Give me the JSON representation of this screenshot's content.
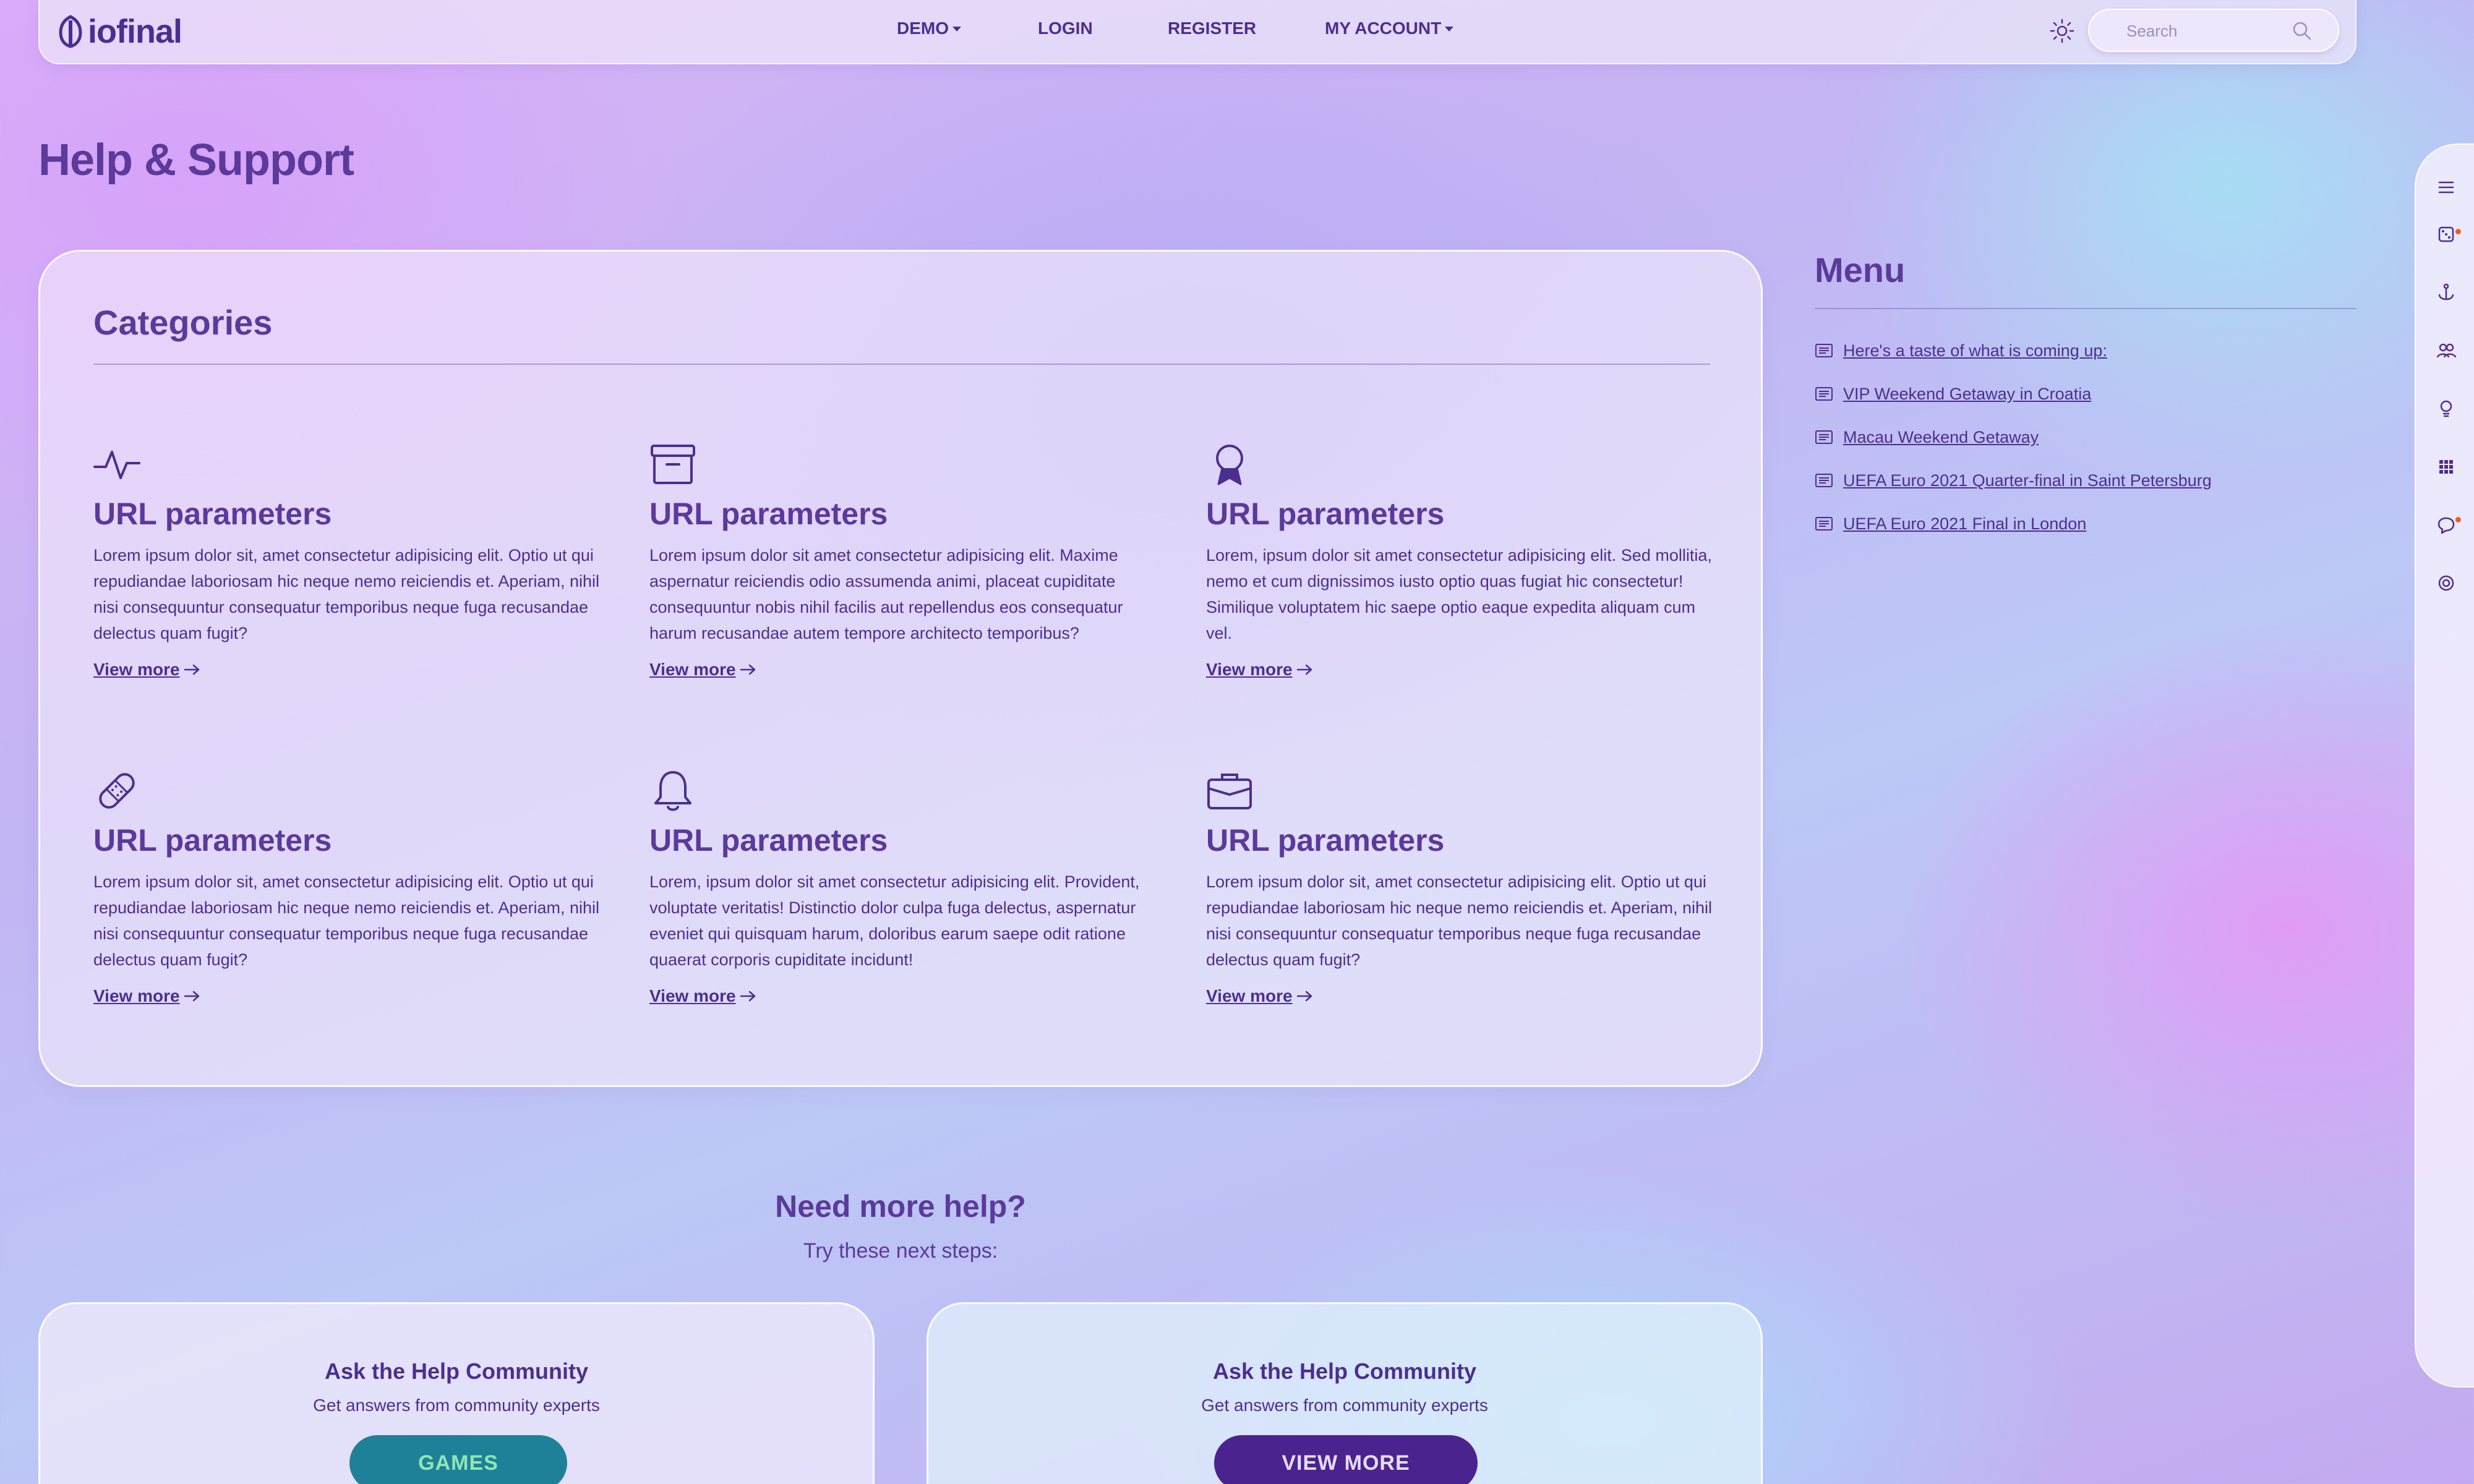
{
  "brand": {
    "name": "iofinal"
  },
  "nav": {
    "demo": "DEMO",
    "login": "LOGIN",
    "register": "REGISTER",
    "account": "MY ACCOUNT"
  },
  "search": {
    "placeholder": "Search"
  },
  "page": {
    "title": "Help & Support"
  },
  "categories": {
    "title": "Categories",
    "items": [
      {
        "icon": "activity-icon",
        "title": "URL parameters",
        "desc": "Lorem ipsum dolor sit, amet consectetur adipisicing elit. Optio ut qui repudiandae laboriosam hic neque nemo reiciendis et. Aperiam, nihil nisi consequuntur consequatur temporibus neque fuga recusandae delectus quam fugit?",
        "link": "View more"
      },
      {
        "icon": "archive-icon",
        "title": "URL parameters",
        "desc": "Lorem ipsum dolor sit amet consectetur adipisicing elit. Maxime aspernatur reiciendis odio assumenda animi, placeat cupiditate consequuntur nobis nihil facilis aut repellendus eos consequatur harum recusandae autem tempore architecto temporibus?",
        "link": "View more"
      },
      {
        "icon": "award-icon",
        "title": "URL parameters",
        "desc": "Lorem, ipsum dolor sit amet consectetur adipisicing elit. Sed mollitia, nemo et cum dignissimos iusto optio quas fugiat hic consectetur! Similique voluptatem hic saepe optio eaque expedita aliquam cum vel.",
        "link": "View more"
      },
      {
        "icon": "bandage-icon",
        "title": "URL parameters",
        "desc": "Lorem ipsum dolor sit, amet consectetur adipisicing elit. Optio ut qui repudiandae laboriosam hic neque nemo reiciendis et. Aperiam, nihil nisi consequuntur consequatur temporibus neque fuga recusandae delectus quam fugit?",
        "link": "View more"
      },
      {
        "icon": "bell-icon",
        "title": "URL parameters",
        "desc": "Lorem, ipsum dolor sit amet consectetur adipisicing elit. Provident, voluptate veritatis! Distinctio dolor culpa fuga delectus, aspernatur eveniet qui quisquam harum, doloribus earum saepe odit ratione quaerat corporis cupiditate incidunt!",
        "link": "View more"
      },
      {
        "icon": "briefcase-icon",
        "title": "URL parameters",
        "desc": "Lorem ipsum dolor sit, amet consectetur adipisicing elit. Optio ut qui repudiandae laboriosam hic neque nemo reiciendis et. Aperiam, nihil nisi consequuntur consequatur temporibus neque fuga recusandae delectus quam fugit?",
        "link": "View more"
      }
    ]
  },
  "menu": {
    "title": "Menu",
    "items": [
      "Here's a taste of what is coming up:",
      "VIP Weekend Getaway in Croatia",
      "Macau Weekend Getaway",
      "UEFA Euro 2021 Quarter-final in Saint Petersburg",
      "UEFA Euro 2021 Final in London"
    ]
  },
  "rail": {
    "icons": [
      "hamburger-menu-icon",
      "casino-icon",
      "anchor-icon",
      "users-icon",
      "lightbulb-icon",
      "grid-icon",
      "chat-icon",
      "target-icon"
    ]
  },
  "help": {
    "title": "Need more help?",
    "subtitle": "Try these next steps:",
    "cards": [
      {
        "title": "Ask the Help Community",
        "subtitle": "Get answers from community experts",
        "button": "GAMES"
      },
      {
        "title": "Ask the Help Community",
        "subtitle": "Get answers from community experts",
        "button": "VIEW MORE"
      }
    ]
  },
  "colors": {
    "primary_text": "#4b2f8f",
    "heading": "#5b3a9b",
    "games_button": "#1f8198",
    "games_button_text": "#8ee6b6",
    "view_more_button": "#4b238f",
    "notification_dot": "#ef5b2d"
  }
}
